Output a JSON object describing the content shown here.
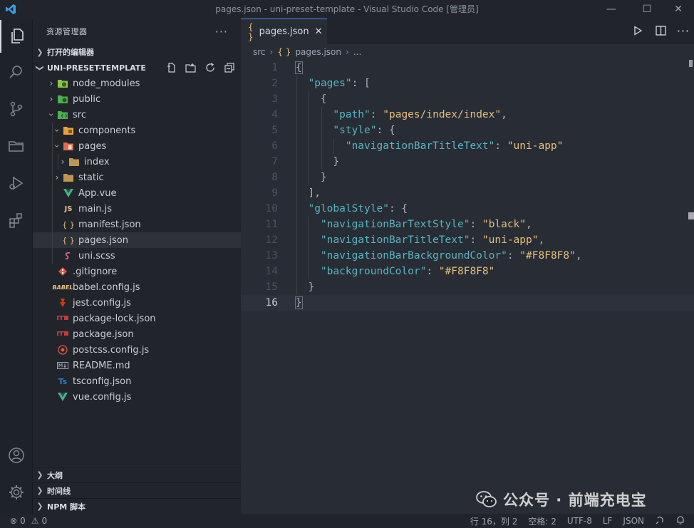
{
  "window": {
    "title": "pages.json - uni-preset-template - Visual Studio Code [管理员]",
    "minimize": "—",
    "maximize": "☐",
    "close": "✕"
  },
  "sidebar": {
    "header": "资源管理器",
    "more": "···",
    "open_editors": "打开的编辑器",
    "project": "UNI-PRESET-TEMPLATE",
    "tree": [
      {
        "label": "node_modules",
        "icon": "folder-node-icon",
        "color": "#8bc34a"
      },
      {
        "label": "public",
        "icon": "folder-public-icon",
        "color": "#4caf50"
      },
      {
        "label": "src",
        "icon": "folder-src-icon",
        "color": "#4caf50"
      },
      {
        "label": "components",
        "icon": "folder-components-icon",
        "color": "#e5c07b"
      },
      {
        "label": "pages",
        "icon": "folder-pages-icon",
        "color": "#e06c4b"
      },
      {
        "label": "index",
        "icon": "folder-icon",
        "color": "#c09553"
      },
      {
        "label": "static",
        "icon": "folder-icon",
        "color": "#c09553"
      },
      {
        "label": "App.vue",
        "icon": "vue-icon",
        "color": "#41b883"
      },
      {
        "label": "main.js",
        "icon": "js-icon",
        "color": "#e5c07b"
      },
      {
        "label": "manifest.json",
        "icon": "json-icon",
        "color": "#e5c07b"
      },
      {
        "label": "pages.json",
        "icon": "json-icon",
        "color": "#e5c07b"
      },
      {
        "label": "uni.scss",
        "icon": "sass-icon",
        "color": "#e06c9f"
      },
      {
        "label": ".gitignore",
        "icon": "git-icon",
        "color": "#e0573f"
      },
      {
        "label": "babel.config.js",
        "icon": "babel-icon",
        "color": "#e5c07b"
      },
      {
        "label": "jest.config.js",
        "icon": "jest-icon",
        "color": "#c63d14"
      },
      {
        "label": "package-lock.json",
        "icon": "npm-icon",
        "color": "#cb3837"
      },
      {
        "label": "package.json",
        "icon": "npm-icon",
        "color": "#cb3837"
      },
      {
        "label": "postcss.config.js",
        "icon": "postcss-icon",
        "color": "#e0573f"
      },
      {
        "label": "README.md",
        "icon": "markdown-icon",
        "color": "#9da5b4"
      },
      {
        "label": "tsconfig.json",
        "icon": "ts-icon",
        "color": "#3178c6"
      },
      {
        "label": "vue.config.js",
        "icon": "vue-icon",
        "color": "#41b883"
      }
    ],
    "outline": "大纲",
    "timeline": "时间线",
    "npm_scripts": "NPM 脚本"
  },
  "editor": {
    "tab_icon": "{ }",
    "tab_label": "pages.json",
    "tab_close": "✕",
    "breadcrumb": {
      "folder": "src",
      "file_icon": "{ }",
      "file": "pages.json",
      "more": "..."
    },
    "line_numbers": [
      "1",
      "2",
      "3",
      "4",
      "5",
      "6",
      "7",
      "8",
      "9",
      "10",
      "11",
      "12",
      "13",
      "14",
      "15",
      "16"
    ]
  },
  "code": [
    [
      {
        "t": "{",
        "c": "p"
      }
    ],
    [
      {
        "t": "  ",
        "c": "p"
      },
      {
        "t": "\"pages\"",
        "c": "key"
      },
      {
        "t": ": [",
        "c": "p"
      }
    ],
    [
      {
        "t": "    {",
        "c": "p"
      }
    ],
    [
      {
        "t": "      ",
        "c": "p"
      },
      {
        "t": "\"path\"",
        "c": "key"
      },
      {
        "t": ": ",
        "c": "p"
      },
      {
        "t": "\"pages/index/index\"",
        "c": "str"
      },
      {
        "t": ",",
        "c": "p"
      }
    ],
    [
      {
        "t": "      ",
        "c": "p"
      },
      {
        "t": "\"style\"",
        "c": "key"
      },
      {
        "t": ": {",
        "c": "p"
      }
    ],
    [
      {
        "t": "        ",
        "c": "p"
      },
      {
        "t": "\"navigationBarTitleText\"",
        "c": "key"
      },
      {
        "t": ": ",
        "c": "p"
      },
      {
        "t": "\"uni-app\"",
        "c": "str"
      }
    ],
    [
      {
        "t": "      }",
        "c": "p"
      }
    ],
    [
      {
        "t": "    }",
        "c": "p"
      }
    ],
    [
      {
        "t": "  ],",
        "c": "p"
      }
    ],
    [
      {
        "t": "  ",
        "c": "p"
      },
      {
        "t": "\"globalStyle\"",
        "c": "key"
      },
      {
        "t": ": {",
        "c": "p"
      }
    ],
    [
      {
        "t": "    ",
        "c": "p"
      },
      {
        "t": "\"navigationBarTextStyle\"",
        "c": "key"
      },
      {
        "t": ": ",
        "c": "p"
      },
      {
        "t": "\"black\"",
        "c": "str"
      },
      {
        "t": ",",
        "c": "p"
      }
    ],
    [
      {
        "t": "    ",
        "c": "p"
      },
      {
        "t": "\"navigationBarTitleText\"",
        "c": "key"
      },
      {
        "t": ": ",
        "c": "p"
      },
      {
        "t": "\"uni-app\"",
        "c": "str"
      },
      {
        "t": ",",
        "c": "p"
      }
    ],
    [
      {
        "t": "    ",
        "c": "p"
      },
      {
        "t": "\"navigationBarBackgroundColor\"",
        "c": "key"
      },
      {
        "t": ": ",
        "c": "p"
      },
      {
        "t": "\"#F8F8F8\"",
        "c": "str"
      },
      {
        "t": ",",
        "c": "p"
      }
    ],
    [
      {
        "t": "    ",
        "c": "p"
      },
      {
        "t": "\"backgroundColor\"",
        "c": "key"
      },
      {
        "t": ": ",
        "c": "p"
      },
      {
        "t": "\"#F8F8F8\"",
        "c": "str"
      }
    ],
    [
      {
        "t": "  }",
        "c": "p"
      }
    ],
    [
      {
        "t": "}",
        "c": "p"
      }
    ]
  ],
  "statusbar": {
    "errors": "0",
    "warnings": "0",
    "position": "行 16，列 2",
    "indent": "空格: 2",
    "encoding": "UTF-8",
    "eol": "LF",
    "language": "JSON"
  },
  "watermark": "公众号 · 前端充电宝",
  "colors": {
    "accent": "#528bff",
    "key": "#56b6c2",
    "string": "#e5c07b",
    "background": "#282c34",
    "sidebar": "#21252b"
  }
}
